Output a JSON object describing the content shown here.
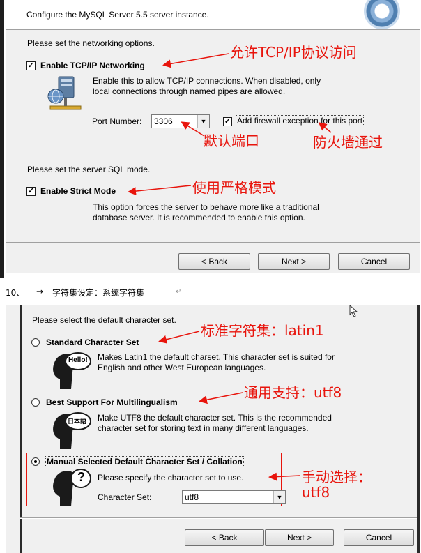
{
  "top_window": {
    "header_subtitle": "Configure the MySQL Server 5.5 server instance.",
    "networking_prompt": "Please set the networking options.",
    "tcp_checkbox_label": "Enable TCP/IP Networking",
    "tcp_description_1": "Enable this to allow TCP/IP connections. When disabled, only",
    "tcp_description_2": "local connections through named pipes are allowed.",
    "port_label": "Port Number:",
    "port_value": "3306",
    "firewall_label": "Add firewall exception for this port",
    "sql_mode_prompt": "Please set the server SQL mode.",
    "strict_label": "Enable Strict Mode",
    "strict_description_1": "This option forces the server to behave more like a traditional",
    "strict_description_2": "database server. It is recommended to enable this option.",
    "back_label": "< Back",
    "next_label": "Next >",
    "cancel_label": "Cancel",
    "check_mark": "✓"
  },
  "annotations_top": {
    "tcp": "允许TCP/IP协议访问",
    "port": "默认端口",
    "firewall": "防火墙通过",
    "strict": "使用严格模式"
  },
  "step_line": {
    "number": "10、",
    "arrow": "→",
    "text": "字符集设定：系统字符集",
    "mark": "↵"
  },
  "bottom_window": {
    "charset_prompt": "Please select the default character set.",
    "standard_label": "Standard Character Set",
    "standard_desc_1": "Makes Latin1 the default charset. This character set is suited for",
    "standard_desc_2": "English and other West European languages.",
    "standard_bubble": "Hello!",
    "multi_label": "Best Support For Multilingualism",
    "multi_desc_1": "Make UTF8 the default character set. This is the recommended",
    "multi_desc_2": "character set for storing text in many different languages.",
    "multi_bubble": "日本語",
    "manual_label": "Manual Selected Default Character Set / Collation",
    "manual_desc": "Please specify the character set to use.",
    "manual_bubble": "?",
    "charset_label": "Character Set:",
    "charset_value": "utf8",
    "back_label": "< Back",
    "next_label": "Next >",
    "cancel_label": "Cancel"
  },
  "annotations_bottom": {
    "standard": "标准字符集：latin1",
    "multi": "通用支持：utf8",
    "manual_1": "手动选择：",
    "manual_2": "utf8"
  },
  "colors": {
    "annotation_red": "#e8140c",
    "dialog_bg": "#f0f0f0"
  }
}
